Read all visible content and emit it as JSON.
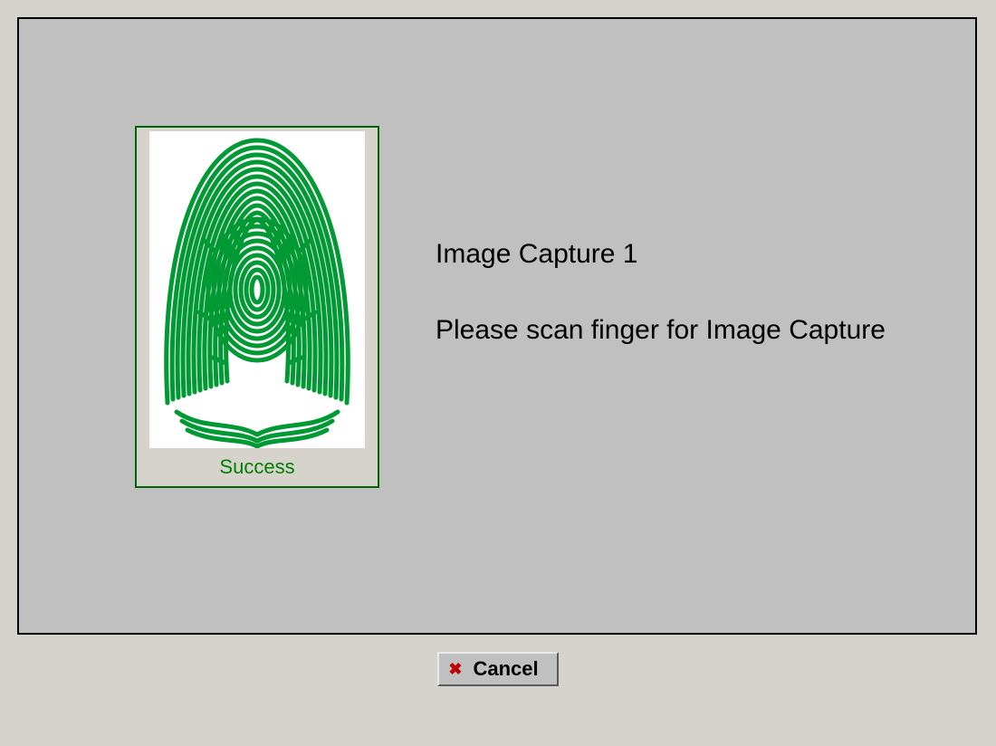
{
  "capture": {
    "title": "Image Capture 1",
    "instruction": "Please scan finger for Image Capture",
    "status_label": "Success",
    "status_color": "#008000",
    "fingerprint_color": "#009933"
  },
  "buttons": {
    "cancel_label": "Cancel",
    "cancel_icon": "✖"
  },
  "colors": {
    "outer_bg": "#d6d3cd",
    "panel_bg": "#c0c0c0",
    "box_border": "#006400",
    "x_color": "#c00000"
  }
}
